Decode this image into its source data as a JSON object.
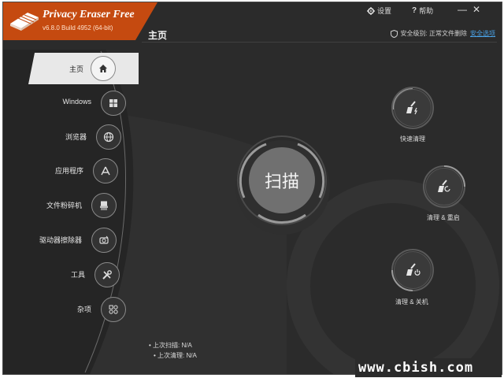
{
  "app": {
    "title": "Privacy Eraser Free",
    "version": "v6.8.0 Build 4952 (64-bit)"
  },
  "topbar": {
    "settings_label": "设置",
    "help_label": "帮助",
    "minimize_label": "—",
    "close_label": "✕"
  },
  "header": {
    "page_title": "主页",
    "security_level_text": "安全级别: 正常文件删除",
    "security_option_link": "安全选项"
  },
  "sidebar": {
    "items": [
      {
        "label": "主页",
        "icon": "home-icon"
      },
      {
        "label": "Windows",
        "icon": "windows-icon"
      },
      {
        "label": "浏览器",
        "icon": "globe-icon"
      },
      {
        "label": "应用程序",
        "icon": "apps-icon"
      },
      {
        "label": "文件粉碎机",
        "icon": "shredder-icon"
      },
      {
        "label": "驱动器擦除器",
        "icon": "drive-wiper-icon"
      },
      {
        "label": "工具",
        "icon": "tools-icon"
      },
      {
        "label": "杂项",
        "icon": "misc-icon"
      }
    ]
  },
  "main": {
    "scan_label": "扫描",
    "actions": [
      {
        "label": "快速清理",
        "icon": "broom-lightning-icon"
      },
      {
        "label": "清理 & 重启",
        "icon": "broom-restart-icon"
      },
      {
        "label": "清理 & 关机",
        "icon": "broom-power-icon"
      }
    ],
    "last_scan_label": "上次扫描:",
    "last_scan_value": "N/A",
    "last_clean_label": "上次清理:",
    "last_clean_value": "N/A"
  },
  "watermark": "www.cbish.com",
  "colors": {
    "brand": "#c54a10",
    "background": "#2b2b2b",
    "link": "#4aa3e8"
  }
}
